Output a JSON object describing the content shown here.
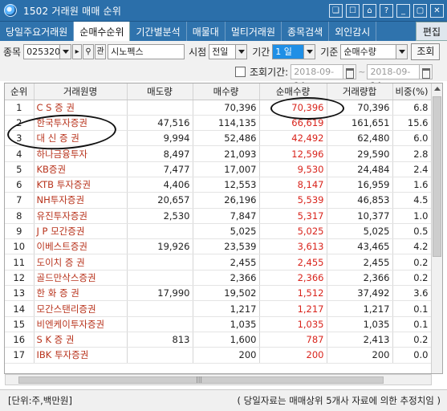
{
  "window": {
    "title": "1502 거래원 매매 순위",
    "buttons": [
      "❑",
      "☐",
      "⌂",
      "?",
      "_",
      "▢",
      "✕"
    ]
  },
  "tabs": [
    {
      "label": "당일주요거래원",
      "active": false
    },
    {
      "label": "순매수순위",
      "active": true
    },
    {
      "label": "기간별분석",
      "active": false
    },
    {
      "label": "매물대",
      "active": false
    },
    {
      "label": "멀티거래원",
      "active": false
    },
    {
      "label": "종목검색",
      "active": false
    },
    {
      "label": "외인감시",
      "active": false
    }
  ],
  "edit_label": "편집",
  "toolbar": {
    "stock_label": "종목",
    "stock_code": "025320",
    "stock_name": "시노펙스",
    "search_label": "관",
    "time_label": "시점",
    "time_value": "전일",
    "period_label": "기간",
    "period_value": "1 일",
    "basis_label": "기준",
    "basis_value": "순매수량",
    "query_label": "조회"
  },
  "date_filter": {
    "label": "조회기간:",
    "start": "2018-09-14",
    "separator": "~",
    "end": "2018-09-14"
  },
  "table": {
    "headers": [
      "순위",
      "거래원명",
      "매도량",
      "매수량",
      "순매수량",
      "거래량합",
      "비중(%)"
    ],
    "rows": [
      [
        "1",
        "C S  증 권",
        "",
        "70,396",
        "70,396",
        "70,396",
        "6.8"
      ],
      [
        "2",
        "한국투자증권",
        "47,516",
        "114,135",
        "66,619",
        "161,651",
        "15.6"
      ],
      [
        "3",
        "대 신  증 권",
        "9,994",
        "52,486",
        "42,492",
        "62,480",
        "6.0"
      ],
      [
        "4",
        "하나금융투자",
        "8,497",
        "21,093",
        "12,596",
        "29,590",
        "2.8"
      ],
      [
        "5",
        "KB증권",
        "7,477",
        "17,007",
        "9,530",
        "24,484",
        "2.4"
      ],
      [
        "6",
        "KTB 투자증권",
        "4,406",
        "12,553",
        "8,147",
        "16,959",
        "1.6"
      ],
      [
        "7",
        "NH투자증권",
        "20,657",
        "26,196",
        "5,539",
        "46,853",
        "4.5"
      ],
      [
        "8",
        "유진투자증권",
        "2,530",
        "7,847",
        "5,317",
        "10,377",
        "1.0"
      ],
      [
        "9",
        "J P 모간증권",
        "",
        "5,025",
        "5,025",
        "5,025",
        "0.5"
      ],
      [
        "10",
        "이베스트증권",
        "19,926",
        "23,539",
        "3,613",
        "43,465",
        "4.2"
      ],
      [
        "11",
        "도이치 증 권",
        "",
        "2,455",
        "2,455",
        "2,455",
        "0.2"
      ],
      [
        "12",
        "골드만삭스증권",
        "",
        "2,366",
        "2,366",
        "2,366",
        "0.2"
      ],
      [
        "13",
        "한 화  증 권",
        "17,990",
        "19,502",
        "1,512",
        "37,492",
        "3.6"
      ],
      [
        "14",
        "모간스탠리증권",
        "",
        "1,217",
        "1,217",
        "1,217",
        "0.1"
      ],
      [
        "15",
        "비엔케이투자증권",
        "",
        "1,035",
        "1,035",
        "1,035",
        "0.1"
      ],
      [
        "16",
        "S  K   증 권",
        "813",
        "1,600",
        "787",
        "2,413",
        "0.2"
      ],
      [
        "17",
        "IBK 투자증권",
        "",
        "200",
        "200",
        "200",
        "0.0"
      ]
    ]
  },
  "status": {
    "unit": "[단위:주,백만원]",
    "note": "( 당일자료는 매매상위 5개사 자료에 의한 추정치임 )"
  }
}
